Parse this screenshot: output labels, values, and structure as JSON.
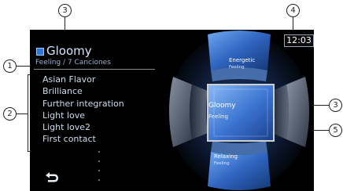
{
  "annotations": {
    "c1": "1",
    "c2": "2",
    "c3_top": "3",
    "c3_right": "3",
    "c4": "4",
    "c5": "5"
  },
  "header": {
    "title": "Gloomy",
    "clock": "12:03"
  },
  "subtitle": "Feeling / 7 Canciones",
  "songs": [
    "Asian Flavor",
    "Brilliance",
    "Further integration",
    "Light love",
    "Light love2",
    "First contact"
  ],
  "sphere": {
    "top_label_line1": "Energetic",
    "top_label_line2": "Feeling",
    "center_label_line1": "Gloomy",
    "center_label_line2": "Feeling",
    "bottom_label_line1": "Relaxing",
    "bottom_label_line2": "Feeling"
  },
  "icons": {
    "back": "back-arrow-icon"
  },
  "colors": {
    "screen_bg": "#000000",
    "accent_blue": "#2e78d8",
    "text_light_blue": "#cfdcee"
  }
}
